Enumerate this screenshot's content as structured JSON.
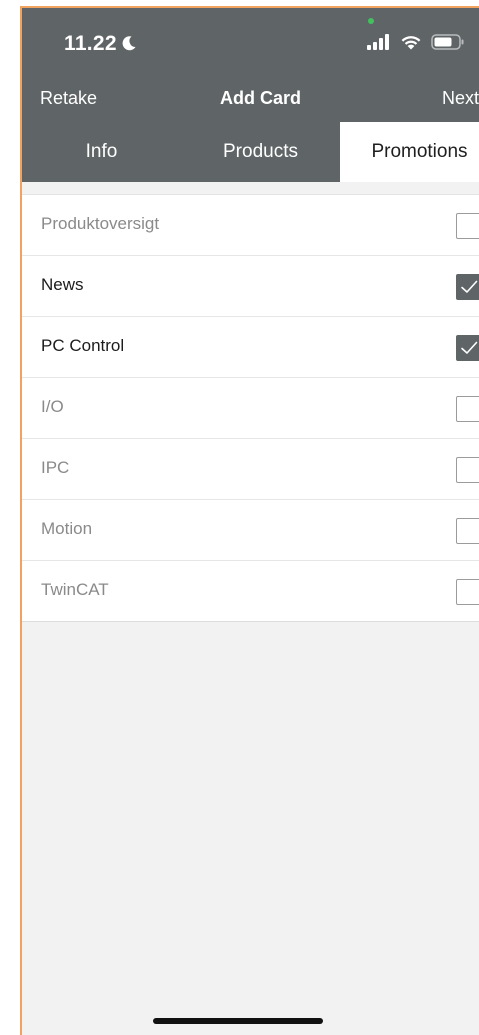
{
  "status_bar": {
    "time": "11.22",
    "icons": [
      "moon-icon",
      "cellular-signal-icon",
      "wifi-icon",
      "battery-icon"
    ]
  },
  "nav": {
    "left_label": "Retake",
    "title": "Add Card",
    "right_label": "Next"
  },
  "tabs": [
    {
      "label": "Info",
      "selected": false
    },
    {
      "label": "Products",
      "selected": false
    },
    {
      "label": "Promotions",
      "selected": true
    }
  ],
  "promotions": [
    {
      "label": "Produktoversigt",
      "checked": false
    },
    {
      "label": "News",
      "checked": true
    },
    {
      "label": "PC Control",
      "checked": true
    },
    {
      "label": "I/O",
      "checked": false
    },
    {
      "label": "IPC",
      "checked": false
    },
    {
      "label": "Motion",
      "checked": false
    },
    {
      "label": "TwinCAT",
      "checked": false
    }
  ],
  "colors": {
    "bar": "#5f6466",
    "accent_border": "#f0a35e",
    "checked": "#5f6466",
    "background": "#f2f2f2"
  }
}
